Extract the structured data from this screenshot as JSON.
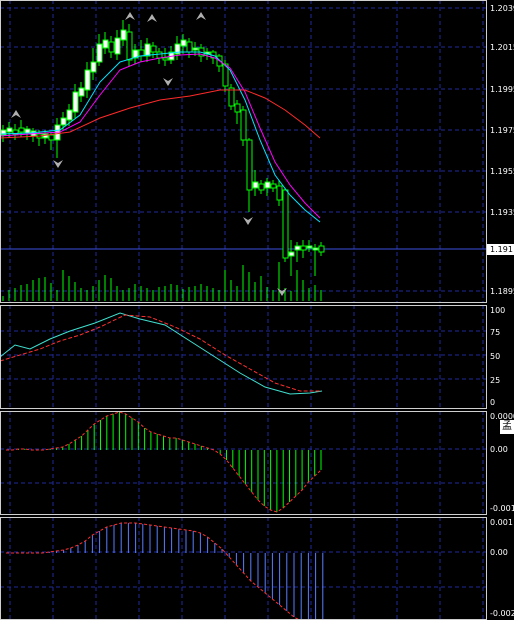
{
  "price_axis": {
    "ticks": [
      "1.2039",
      "1.2015",
      "1.1995",
      "1.1975",
      "1.1955",
      "1.1935",
      "1.1895"
    ],
    "current_price_label": "1.191"
  },
  "stoch_axis": {
    "ticks": [
      "100",
      "75",
      "50",
      "25",
      "0"
    ]
  },
  "macd1_axis": {
    "ticks": [
      "0.0000",
      "0.00",
      "-0.001"
    ],
    "icon_label": "孟"
  },
  "macd2_axis": {
    "ticks": [
      "0.001",
      "0.00",
      "-0.002"
    ]
  },
  "colors": {
    "background": "#000000",
    "grid": "#1f2a9a",
    "bull_candle": "#ffffff",
    "bear_candle": "#000000",
    "candle_wick": "#00ff00",
    "ma_fast": "#00e5ff",
    "ma_mid": "#ff00ff",
    "ma_slow": "#ff2a2a",
    "volume": "#00ff00",
    "stoch_main": "#40e0d0",
    "stoch_signal": "#ff3030",
    "osma_bars": "#00ff00",
    "macd_bars": "#5a7dff",
    "fractal": "#b0b0b0"
  }
}
